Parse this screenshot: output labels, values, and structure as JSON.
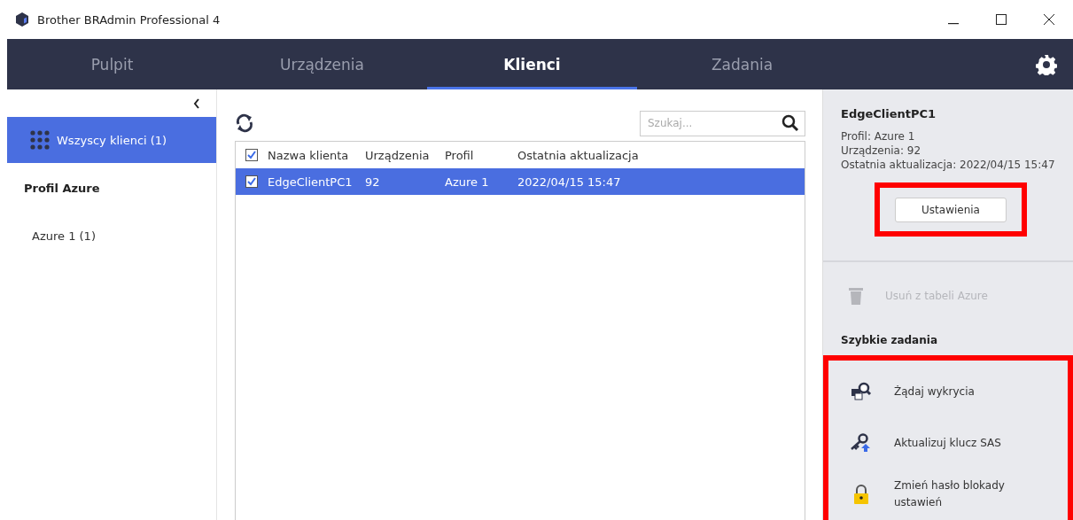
{
  "window": {
    "title": "Brother BRAdmin Professional 4"
  },
  "tabs": [
    {
      "label": "Pulpit",
      "selected": false
    },
    {
      "label": "Urządzenia",
      "selected": false
    },
    {
      "label": "Klienci",
      "selected": true
    },
    {
      "label": "Zadania",
      "selected": false
    }
  ],
  "sidebar": {
    "items": [
      {
        "kind": "item",
        "label": "Wszyscy klienci (1)",
        "selected": true
      },
      {
        "kind": "heading",
        "label": "Profil Azure"
      },
      {
        "kind": "item",
        "label": "Azure 1 (1)",
        "selected": false
      }
    ]
  },
  "search": {
    "placeholder": "Szukaj..."
  },
  "table": {
    "all_checked": true,
    "columns": [
      "Nazwa klienta",
      "Urządzenia",
      "Profil",
      "Ostatnia aktualizacja"
    ],
    "rows": [
      {
        "checked": true,
        "selected": true,
        "cells": [
          "EdgeClientPC1",
          "92",
          "Azure 1",
          "2022/04/15 15:47"
        ]
      }
    ]
  },
  "details": {
    "title": "EdgeClientPC1",
    "lines": [
      "Profil: Azure 1",
      "Urządzenia: 92",
      "Ostatnia aktualizacja: 2022/04/15 15:47"
    ],
    "button": "Ustawienia",
    "highlighted": true
  },
  "delete_action": {
    "label": "Usuń z tabeli Azure",
    "disabled": true
  },
  "quick_tasks": {
    "title": "Szybkie zadania",
    "highlighted": true,
    "items": [
      {
        "kind": "discover",
        "label": "Żądaj wykrycia"
      },
      {
        "kind": "key",
        "label": "Aktualizuj klucz SAS"
      },
      {
        "kind": "lock",
        "label": "Zmień hasło blokady ustawień"
      }
    ]
  }
}
